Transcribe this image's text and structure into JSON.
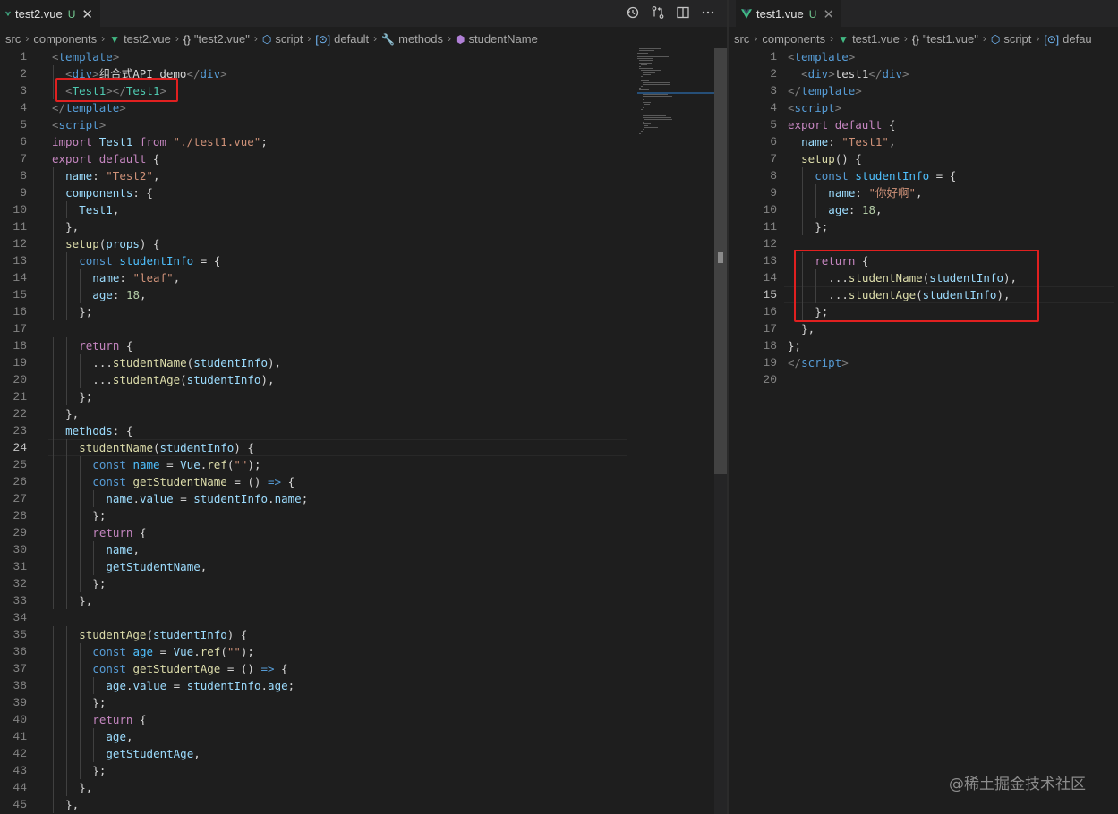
{
  "left": {
    "tab": {
      "filename": "test2.vue",
      "status": "U",
      "close": "✕"
    },
    "actions": [
      "history-icon",
      "compare-changes-icon",
      "split-editor-icon",
      "more-actions-icon"
    ],
    "breadcrumb": [
      {
        "label": "src",
        "icon": ""
      },
      {
        "label": "components",
        "icon": ""
      },
      {
        "label": "test2.vue",
        "icon": "vue-icon"
      },
      {
        "label": "\"test2.vue\"",
        "icon": "braces-icon"
      },
      {
        "label": "script",
        "icon": "cube-icon"
      },
      {
        "label": "default",
        "icon": "object-icon"
      },
      {
        "label": "methods",
        "icon": "wrench-icon"
      },
      {
        "label": "studentName",
        "icon": "method-icon"
      }
    ],
    "active_line": 24,
    "lines": [
      {
        "n": 1,
        "i": 0,
        "t": [
          [
            "t-br",
            "<"
          ],
          [
            "t-tag",
            "template"
          ],
          [
            "t-br",
            ">"
          ]
        ]
      },
      {
        "n": 2,
        "i": 1,
        "t": [
          [
            "t-br",
            "<"
          ],
          [
            "t-tag",
            "div"
          ],
          [
            "t-br",
            ">"
          ],
          [
            "t-txt",
            "组合式API demo"
          ],
          [
            "t-br",
            "</"
          ],
          [
            "t-tag",
            "div"
          ],
          [
            "t-br",
            ">"
          ]
        ]
      },
      {
        "n": 3,
        "i": 1,
        "t": [
          [
            "t-br",
            "<"
          ],
          [
            "t-cls",
            "Test1"
          ],
          [
            "t-br",
            "></"
          ],
          [
            "t-cls",
            "Test1"
          ],
          [
            "t-br",
            ">"
          ]
        ]
      },
      {
        "n": 4,
        "i": 0,
        "t": [
          [
            "t-br",
            "</"
          ],
          [
            "t-tag",
            "template"
          ],
          [
            "t-br",
            ">"
          ]
        ]
      },
      {
        "n": 5,
        "i": 0,
        "t": [
          [
            "t-br",
            "<"
          ],
          [
            "t-tag",
            "script"
          ],
          [
            "t-br",
            ">"
          ]
        ]
      },
      {
        "n": 6,
        "i": 0,
        "t": [
          [
            "t-kw2",
            "import "
          ],
          [
            "t-prop",
            "Test1 "
          ],
          [
            "t-kw2",
            "from "
          ],
          [
            "t-str",
            "\"./test1.vue\""
          ],
          [
            "t-txt",
            ";"
          ]
        ]
      },
      {
        "n": 7,
        "i": 0,
        "t": [
          [
            "t-kw2",
            "export "
          ],
          [
            "t-kw2",
            "default "
          ],
          [
            "t-txt",
            "{"
          ]
        ]
      },
      {
        "n": 8,
        "i": 1,
        "t": [
          [
            "t-prop",
            "name"
          ],
          [
            "t-txt",
            ": "
          ],
          [
            "t-str",
            "\"Test2\""
          ],
          [
            "t-txt",
            ","
          ]
        ]
      },
      {
        "n": 9,
        "i": 1,
        "t": [
          [
            "t-prop",
            "components"
          ],
          [
            "t-txt",
            ": {"
          ]
        ]
      },
      {
        "n": 10,
        "i": 2,
        "t": [
          [
            "t-prop",
            "Test1"
          ],
          [
            "t-txt",
            ","
          ]
        ]
      },
      {
        "n": 11,
        "i": 1,
        "t": [
          [
            "t-txt",
            "},"
          ]
        ]
      },
      {
        "n": 12,
        "i": 1,
        "t": [
          [
            "t-fn",
            "setup"
          ],
          [
            "t-txt",
            "("
          ],
          [
            "t-prop",
            "props"
          ],
          [
            "t-txt",
            ") {"
          ]
        ]
      },
      {
        "n": 13,
        "i": 2,
        "t": [
          [
            "t-kw",
            "const "
          ],
          [
            "t-var",
            "studentInfo "
          ],
          [
            "t-txt",
            "= {"
          ]
        ]
      },
      {
        "n": 14,
        "i": 3,
        "t": [
          [
            "t-prop",
            "name"
          ],
          [
            "t-txt",
            ": "
          ],
          [
            "t-str",
            "\"leaf\""
          ],
          [
            "t-txt",
            ","
          ]
        ]
      },
      {
        "n": 15,
        "i": 3,
        "t": [
          [
            "t-prop",
            "age"
          ],
          [
            "t-txt",
            ": "
          ],
          [
            "t-num",
            "18"
          ],
          [
            "t-txt",
            ","
          ]
        ]
      },
      {
        "n": 16,
        "i": 2,
        "t": [
          [
            "t-txt",
            "};"
          ]
        ]
      },
      {
        "n": 17,
        "i": 0,
        "t": []
      },
      {
        "n": 18,
        "i": 2,
        "t": [
          [
            "t-kw2",
            "return "
          ],
          [
            "t-txt",
            "{"
          ]
        ]
      },
      {
        "n": 19,
        "i": 3,
        "t": [
          [
            "t-txt",
            "..."
          ],
          [
            "t-fn",
            "studentName"
          ],
          [
            "t-txt",
            "("
          ],
          [
            "t-prop",
            "studentInfo"
          ],
          [
            "t-txt",
            "),"
          ]
        ]
      },
      {
        "n": 20,
        "i": 3,
        "t": [
          [
            "t-txt",
            "..."
          ],
          [
            "t-fn",
            "studentAge"
          ],
          [
            "t-txt",
            "("
          ],
          [
            "t-prop",
            "studentInfo"
          ],
          [
            "t-txt",
            "),"
          ]
        ]
      },
      {
        "n": 21,
        "i": 2,
        "t": [
          [
            "t-txt",
            "};"
          ]
        ]
      },
      {
        "n": 22,
        "i": 1,
        "t": [
          [
            "t-txt",
            "},"
          ]
        ]
      },
      {
        "n": 23,
        "i": 1,
        "t": [
          [
            "t-prop",
            "methods"
          ],
          [
            "t-txt",
            ": {"
          ]
        ]
      },
      {
        "n": 24,
        "i": 2,
        "t": [
          [
            "t-fn",
            "studentName"
          ],
          [
            "t-txt",
            "("
          ],
          [
            "t-prop",
            "studentInfo"
          ],
          [
            "t-txt",
            ") {"
          ]
        ]
      },
      {
        "n": 25,
        "i": 3,
        "t": [
          [
            "t-kw",
            "const "
          ],
          [
            "t-var",
            "name "
          ],
          [
            "t-txt",
            "= "
          ],
          [
            "t-prop",
            "Vue"
          ],
          [
            "t-txt",
            "."
          ],
          [
            "t-fn",
            "ref"
          ],
          [
            "t-txt",
            "("
          ],
          [
            "t-str",
            "\"\""
          ],
          [
            "t-txt",
            ");"
          ]
        ]
      },
      {
        "n": 26,
        "i": 3,
        "t": [
          [
            "t-kw",
            "const "
          ],
          [
            "t-fn",
            "getStudentName "
          ],
          [
            "t-txt",
            "= () "
          ],
          [
            "t-kw",
            "=> "
          ],
          [
            "t-txt",
            "{"
          ]
        ]
      },
      {
        "n": 27,
        "i": 4,
        "t": [
          [
            "t-prop",
            "name"
          ],
          [
            "t-txt",
            "."
          ],
          [
            "t-prop",
            "value "
          ],
          [
            "t-txt",
            "= "
          ],
          [
            "t-prop",
            "studentInfo"
          ],
          [
            "t-txt",
            "."
          ],
          [
            "t-prop",
            "name"
          ],
          [
            "t-txt",
            ";"
          ]
        ]
      },
      {
        "n": 28,
        "i": 3,
        "t": [
          [
            "t-txt",
            "};"
          ]
        ]
      },
      {
        "n": 29,
        "i": 3,
        "t": [
          [
            "t-kw2",
            "return "
          ],
          [
            "t-txt",
            "{"
          ]
        ]
      },
      {
        "n": 30,
        "i": 4,
        "t": [
          [
            "t-prop",
            "name"
          ],
          [
            "t-txt",
            ","
          ]
        ]
      },
      {
        "n": 31,
        "i": 4,
        "t": [
          [
            "t-prop",
            "getStudentName"
          ],
          [
            "t-txt",
            ","
          ]
        ]
      },
      {
        "n": 32,
        "i": 3,
        "t": [
          [
            "t-txt",
            "};"
          ]
        ]
      },
      {
        "n": 33,
        "i": 2,
        "t": [
          [
            "t-txt",
            "},"
          ]
        ]
      },
      {
        "n": 34,
        "i": 0,
        "t": []
      },
      {
        "n": 35,
        "i": 2,
        "t": [
          [
            "t-fn",
            "studentAge"
          ],
          [
            "t-txt",
            "("
          ],
          [
            "t-prop",
            "studentInfo"
          ],
          [
            "t-txt",
            ") {"
          ]
        ]
      },
      {
        "n": 36,
        "i": 3,
        "t": [
          [
            "t-kw",
            "const "
          ],
          [
            "t-var",
            "age "
          ],
          [
            "t-txt",
            "= "
          ],
          [
            "t-prop",
            "Vue"
          ],
          [
            "t-txt",
            "."
          ],
          [
            "t-fn",
            "ref"
          ],
          [
            "t-txt",
            "("
          ],
          [
            "t-str",
            "\"\""
          ],
          [
            "t-txt",
            ");"
          ]
        ]
      },
      {
        "n": 37,
        "i": 3,
        "t": [
          [
            "t-kw",
            "const "
          ],
          [
            "t-fn",
            "getStudentAge "
          ],
          [
            "t-txt",
            "= () "
          ],
          [
            "t-kw",
            "=> "
          ],
          [
            "t-txt",
            "{"
          ]
        ]
      },
      {
        "n": 38,
        "i": 4,
        "t": [
          [
            "t-prop",
            "age"
          ],
          [
            "t-txt",
            "."
          ],
          [
            "t-prop",
            "value "
          ],
          [
            "t-txt",
            "= "
          ],
          [
            "t-prop",
            "studentInfo"
          ],
          [
            "t-txt",
            "."
          ],
          [
            "t-prop",
            "age"
          ],
          [
            "t-txt",
            ";"
          ]
        ]
      },
      {
        "n": 39,
        "i": 3,
        "t": [
          [
            "t-txt",
            "};"
          ]
        ]
      },
      {
        "n": 40,
        "i": 3,
        "t": [
          [
            "t-kw2",
            "return "
          ],
          [
            "t-txt",
            "{"
          ]
        ]
      },
      {
        "n": 41,
        "i": 4,
        "t": [
          [
            "t-prop",
            "age"
          ],
          [
            "t-txt",
            ","
          ]
        ]
      },
      {
        "n": 42,
        "i": 4,
        "t": [
          [
            "t-prop",
            "getStudentAge"
          ],
          [
            "t-txt",
            ","
          ]
        ]
      },
      {
        "n": 43,
        "i": 3,
        "t": [
          [
            "t-txt",
            "};"
          ]
        ]
      },
      {
        "n": 44,
        "i": 2,
        "t": [
          [
            "t-txt",
            "},"
          ]
        ]
      },
      {
        "n": 45,
        "i": 1,
        "t": [
          [
            "t-txt",
            "},"
          ]
        ]
      }
    ]
  },
  "right": {
    "tab": {
      "filename": "test1.vue",
      "status": "U",
      "close": "✕"
    },
    "breadcrumb": [
      {
        "label": "src",
        "icon": ""
      },
      {
        "label": "components",
        "icon": ""
      },
      {
        "label": "test1.vue",
        "icon": "vue-icon"
      },
      {
        "label": "\"test1.vue\"",
        "icon": "braces-icon"
      },
      {
        "label": "script",
        "icon": "cube-icon"
      },
      {
        "label": "defau",
        "icon": "object-icon"
      }
    ],
    "active_line": 15,
    "lines": [
      {
        "n": 1,
        "i": 0,
        "t": [
          [
            "t-br",
            "<"
          ],
          [
            "t-tag",
            "template"
          ],
          [
            "t-br",
            ">"
          ]
        ]
      },
      {
        "n": 2,
        "i": 1,
        "t": [
          [
            "t-br",
            "<"
          ],
          [
            "t-tag",
            "div"
          ],
          [
            "t-br",
            ">"
          ],
          [
            "t-txt",
            "test1"
          ],
          [
            "t-br",
            "</"
          ],
          [
            "t-tag",
            "div"
          ],
          [
            "t-br",
            ">"
          ]
        ]
      },
      {
        "n": 3,
        "i": 0,
        "t": [
          [
            "t-br",
            "</"
          ],
          [
            "t-tag",
            "template"
          ],
          [
            "t-br",
            ">"
          ]
        ]
      },
      {
        "n": 4,
        "i": 0,
        "t": [
          [
            "t-br",
            "<"
          ],
          [
            "t-tag",
            "script"
          ],
          [
            "t-br",
            ">"
          ]
        ]
      },
      {
        "n": 5,
        "i": 0,
        "t": [
          [
            "t-kw2",
            "export "
          ],
          [
            "t-kw2",
            "default "
          ],
          [
            "t-txt",
            "{"
          ]
        ]
      },
      {
        "n": 6,
        "i": 1,
        "t": [
          [
            "t-prop",
            "name"
          ],
          [
            "t-txt",
            ": "
          ],
          [
            "t-str",
            "\"Test1\""
          ],
          [
            "t-txt",
            ","
          ]
        ]
      },
      {
        "n": 7,
        "i": 1,
        "t": [
          [
            "t-fn",
            "setup"
          ],
          [
            "t-txt",
            "() {"
          ]
        ]
      },
      {
        "n": 8,
        "i": 2,
        "t": [
          [
            "t-kw",
            "const "
          ],
          [
            "t-var",
            "studentInfo "
          ],
          [
            "t-txt",
            "= {"
          ]
        ]
      },
      {
        "n": 9,
        "i": 3,
        "t": [
          [
            "t-prop",
            "name"
          ],
          [
            "t-txt",
            ": "
          ],
          [
            "t-str",
            "\"你好啊\""
          ],
          [
            "t-txt",
            ","
          ]
        ]
      },
      {
        "n": 10,
        "i": 3,
        "t": [
          [
            "t-prop",
            "age"
          ],
          [
            "t-txt",
            ": "
          ],
          [
            "t-num",
            "18"
          ],
          [
            "t-txt",
            ","
          ]
        ]
      },
      {
        "n": 11,
        "i": 2,
        "t": [
          [
            "t-txt",
            "};"
          ]
        ]
      },
      {
        "n": 12,
        "i": 0,
        "t": []
      },
      {
        "n": 13,
        "i": 2,
        "t": [
          [
            "t-kw2",
            "return "
          ],
          [
            "t-txt",
            "{"
          ]
        ]
      },
      {
        "n": 14,
        "i": 3,
        "t": [
          [
            "t-txt",
            "..."
          ],
          [
            "t-fn",
            "studentName"
          ],
          [
            "t-txt",
            "("
          ],
          [
            "t-prop",
            "studentInfo"
          ],
          [
            "t-txt",
            "),"
          ]
        ]
      },
      {
        "n": 15,
        "i": 3,
        "t": [
          [
            "t-txt",
            "..."
          ],
          [
            "t-fn",
            "studentAge"
          ],
          [
            "t-txt",
            "("
          ],
          [
            "t-prop",
            "studentInfo"
          ],
          [
            "t-txt",
            "),"
          ]
        ]
      },
      {
        "n": 16,
        "i": 2,
        "t": [
          [
            "t-txt",
            "};"
          ]
        ]
      },
      {
        "n": 17,
        "i": 1,
        "t": [
          [
            "t-txt",
            "},"
          ]
        ]
      },
      {
        "n": 18,
        "i": 0,
        "t": [
          [
            "t-txt",
            "};"
          ]
        ]
      },
      {
        "n": 19,
        "i": 0,
        "t": [
          [
            "t-br",
            "</"
          ],
          [
            "t-tag",
            "script"
          ],
          [
            "t-br",
            ">"
          ]
        ]
      },
      {
        "n": 20,
        "i": 0,
        "t": []
      }
    ]
  },
  "watermark": "@稀土掘金技术社区"
}
